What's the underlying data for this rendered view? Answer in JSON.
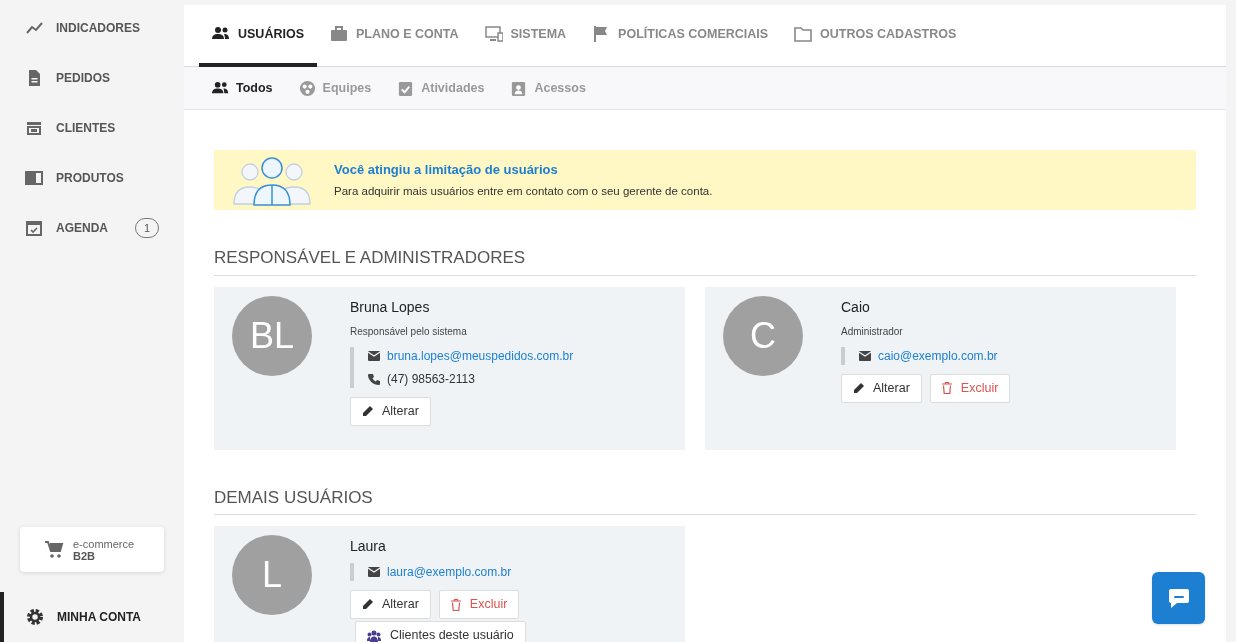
{
  "sidebar": {
    "items": [
      {
        "label": "INDICADORES"
      },
      {
        "label": "PEDIDOS"
      },
      {
        "label": "CLIENTES"
      },
      {
        "label": "PRODUTOS"
      },
      {
        "label": "AGENDA",
        "badge": "1"
      }
    ],
    "store_card": {
      "line1": "e-commerce",
      "line2": "B2B"
    },
    "account": {
      "label": "MINHA CONTA",
      "selected": true
    }
  },
  "tabs": [
    {
      "label": "USUÁRIOS",
      "selected": true
    },
    {
      "label": "PLANO E CONTA",
      "selected": false
    },
    {
      "label": "SISTEMA",
      "selected": false
    },
    {
      "label": "POLÍTICAS COMERCIAIS",
      "selected": false
    },
    {
      "label": "OUTROS CADASTROS",
      "selected": false
    }
  ],
  "subtabs": [
    {
      "label": "Todos",
      "selected": true
    },
    {
      "label": "Equipes",
      "selected": false
    },
    {
      "label": "Atividades",
      "selected": false
    },
    {
      "label": "Acessos",
      "selected": false
    }
  ],
  "alert": {
    "title": "Você atingiu a limitação de usuários",
    "text": "Para adquirir mais usuários entre em contato com o seu gerente de conta."
  },
  "sections": [
    {
      "title": "RESPONSÁVEL E ADMINISTRADORES",
      "users": [
        {
          "initials": "BL",
          "name": "Bruna Lopes",
          "role": "Responsável pelo sistema",
          "email": "bruna.lopes@meuspedidos.com.br",
          "phone": "(47) 98563-2113",
          "actions": [
            {
              "kind": "edit",
              "label": "Alterar"
            }
          ]
        },
        {
          "initials": "C",
          "name": "Caio",
          "role": "Administrador",
          "email": "caio@exemplo.com.br",
          "actions": [
            {
              "kind": "edit",
              "label": "Alterar"
            },
            {
              "kind": "delete",
              "label": "Excluir"
            }
          ]
        }
      ]
    },
    {
      "title": "DEMAIS USUÁRIOS",
      "users": [
        {
          "initials": "L",
          "name": "Laura",
          "email": "laura@exemplo.com.br",
          "actions": [
            {
              "kind": "edit",
              "label": "Alterar"
            },
            {
              "kind": "delete",
              "label": "Excluir"
            },
            {
              "kind": "clients",
              "label": "Clientes deste usuário"
            }
          ]
        }
      ]
    }
  ]
}
